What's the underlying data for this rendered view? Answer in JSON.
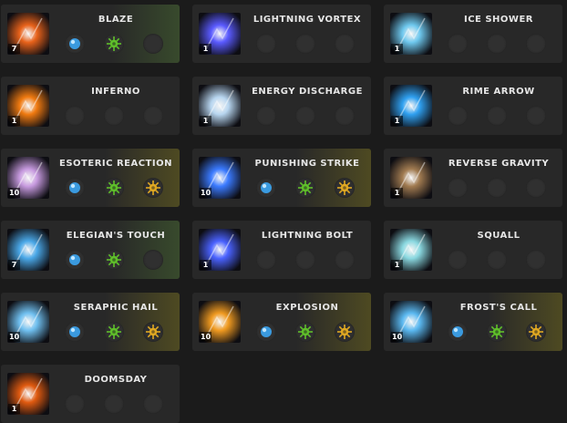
{
  "skills": [
    {
      "name": "BLAZE",
      "level": "7",
      "color": "#e8621a",
      "accent": "green",
      "runes": [
        "blue-orb",
        "green-sun",
        "empty"
      ]
    },
    {
      "name": "LIGHTNING VORTEX",
      "level": "1",
      "color": "#5a5aff",
      "accent": "none",
      "runes": [
        "empty",
        "empty",
        "empty"
      ]
    },
    {
      "name": "ICE SHOWER",
      "level": "1",
      "color": "#6ec8ee",
      "accent": "none",
      "runes": [
        "empty",
        "empty",
        "empty"
      ]
    },
    {
      "name": "INFERNO",
      "level": "1",
      "color": "#f07a10",
      "accent": "none",
      "runes": [
        "empty",
        "empty",
        "empty"
      ]
    },
    {
      "name": "ENERGY DISCHARGE",
      "level": "1",
      "color": "#b8d6f0",
      "accent": "none",
      "runes": [
        "empty",
        "empty",
        "empty"
      ]
    },
    {
      "name": "RIME ARROW",
      "level": "1",
      "color": "#2fa0f0",
      "accent": "none",
      "runes": [
        "empty",
        "empty",
        "empty"
      ]
    },
    {
      "name": "ESOTERIC REACTION",
      "level": "10",
      "color": "#c79adf",
      "accent": "gold",
      "runes": [
        "blue-orb",
        "green-sun",
        "gold-sun"
      ]
    },
    {
      "name": "PUNISHING STRIKE",
      "level": "10",
      "color": "#3a7aff",
      "accent": "gold",
      "runes": [
        "blue-orb",
        "green-sun",
        "gold-sun"
      ]
    },
    {
      "name": "REVERSE GRAVITY",
      "level": "1",
      "color": "#a07a50",
      "accent": "none",
      "runes": [
        "empty",
        "empty",
        "empty"
      ]
    },
    {
      "name": "ELEGIAN'S TOUCH",
      "level": "7",
      "color": "#4aa8e8",
      "accent": "green",
      "runes": [
        "blue-orb",
        "green-sun",
        "empty"
      ]
    },
    {
      "name": "LIGHTNING BOLT",
      "level": "1",
      "color": "#4a62ff",
      "accent": "none",
      "runes": [
        "empty",
        "empty",
        "empty"
      ]
    },
    {
      "name": "SQUALL",
      "level": "1",
      "color": "#8ad8e0",
      "accent": "none",
      "runes": [
        "empty",
        "empty",
        "empty"
      ]
    },
    {
      "name": "SERAPHIC HAIL",
      "level": "10",
      "color": "#70c0f0",
      "accent": "gold",
      "runes": [
        "blue-orb",
        "green-sun",
        "gold-sun"
      ]
    },
    {
      "name": "EXPLOSION",
      "level": "10",
      "color": "#f09a20",
      "accent": "gold",
      "runes": [
        "blue-orb",
        "green-sun",
        "gold-sun"
      ]
    },
    {
      "name": "FROST'S CALL",
      "level": "10",
      "color": "#5ab8f0",
      "accent": "gold",
      "runes": [
        "blue-orb",
        "green-sun",
        "gold-sun"
      ]
    },
    {
      "name": "DOOMSDAY",
      "level": "1",
      "color": "#e05a10",
      "accent": "none",
      "runes": [
        "empty",
        "empty",
        "empty"
      ]
    }
  ],
  "rune_colors": {
    "blue-orb": "#3a9adf",
    "green-sun": "#5fbf2a",
    "gold-sun": "#e0a822"
  }
}
